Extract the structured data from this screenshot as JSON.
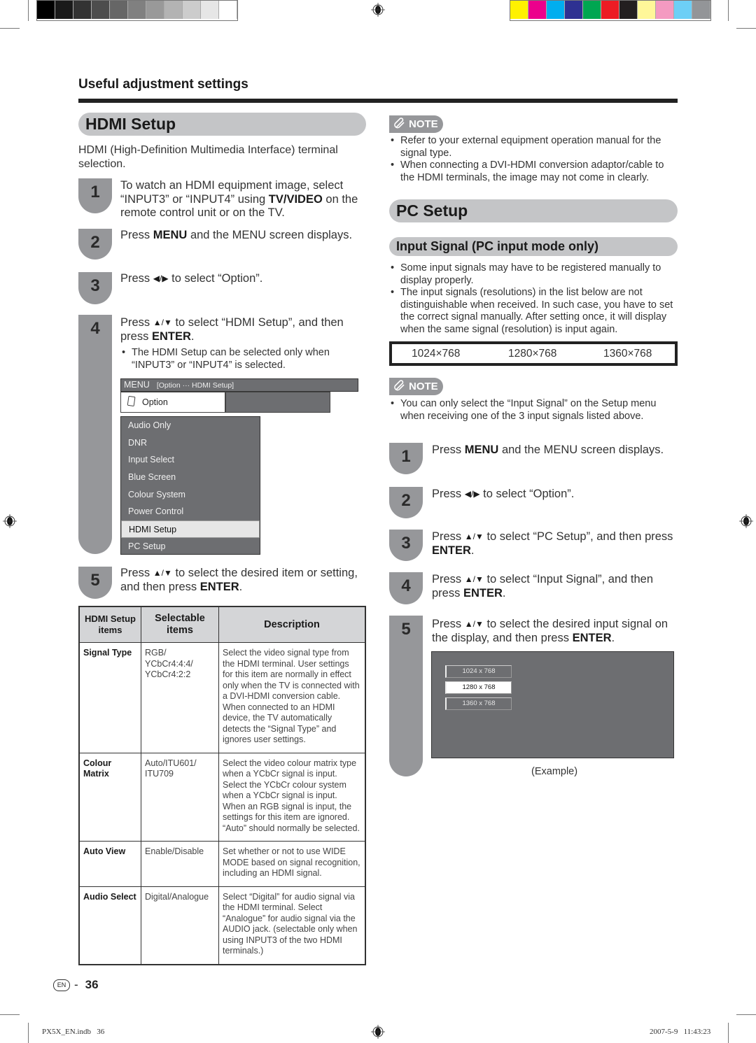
{
  "print_marks": {
    "grayscale_swatches": [
      "#000000",
      "#1a1a1a",
      "#333333",
      "#4d4d4d",
      "#666666",
      "#808080",
      "#999999",
      "#b3b3b3",
      "#cccccc",
      "#e6e6e6",
      "#ffffff"
    ],
    "color_swatches": [
      "#fff100",
      "#ec008c",
      "#00aeef",
      "#2e3192",
      "#00a651",
      "#ed1c24",
      "#231f20",
      "#fff799",
      "#f49ac1",
      "#6dcff6",
      "#939598"
    ]
  },
  "header": {
    "section_title": "Useful adjustment settings"
  },
  "hdmi_setup": {
    "title": "HDMI Setup",
    "intro": "HDMI (High-Definition Multimedia Interface) terminal selection.",
    "steps": [
      {
        "number": "1",
        "parts": [
          "To watch an HDMI equipment image, select “INPUT3” or “INPUT4” using ",
          "TV/VIDEO",
          " on the remote control unit or on the TV."
        ]
      },
      {
        "number": "2",
        "parts": [
          "Press ",
          "MENU",
          " and the MENU screen displays."
        ]
      },
      {
        "number": "3",
        "parts": [
          "Press ",
          "◀/▶",
          " to select “Option”."
        ]
      },
      {
        "number": "4",
        "parts": [
          "Press ",
          "▲/▼",
          " to select  “HDMI Setup”, and then press ",
          "ENTER",
          "."
        ],
        "note": "The HDMI Setup can be selected only when “INPUT3” or “INPUT4” is selected."
      },
      {
        "number": "5",
        "parts": [
          "Press ",
          "▲/▼",
          " to select the desired item or setting, and then press ",
          "ENTER",
          "."
        ]
      }
    ],
    "menu_screen": {
      "menu_label": "MENU",
      "breadcrumb": "[Option ··· HDMI Setup]",
      "tab_label": "Option",
      "items": [
        "Audio Only",
        "DNR",
        "Input Select",
        "Blue Screen",
        "Colour System",
        "Power Control",
        "HDMI Setup",
        "PC Setup"
      ],
      "selected_item": "HDMI Setup"
    },
    "table": {
      "headers": [
        "HDMI Setup items",
        "Selectable items",
        "Description"
      ],
      "rows": [
        {
          "item": "Signal Type",
          "selectable": "RGB/ YCbCr4:4:4/ YCbCr4:2:2",
          "description": "Select the video signal type from the HDMI terminal. User settings for this item are normally in effect only when the TV is connected with a DVI-HDMI conversion cable. When connected to an HDMI device, the TV automatically detects the “Signal Type” and ignores user settings."
        },
        {
          "item": "Colour Matrix",
          "selectable": "Auto/ITU601/ ITU709",
          "description": "Select the video colour matrix type when a YCbCr signal is input. Select the YCbCr colour system when a YCbCr signal is input. When an RGB signal is input, the settings for this item are ignored. “Auto” should normally be selected."
        },
        {
          "item": "Auto View",
          "selectable": "Enable/Disable",
          "description": "Set whether or not to use WIDE MODE based on signal recognition, including an HDMI signal."
        },
        {
          "item": "Audio Select",
          "selectable": "Digital/Analogue",
          "description": "Select “Digital” for audio signal via the HDMI terminal. Select “Analogue” for audio signal via the AUDIO jack. (selectable only when using INPUT3 of the two HDMI terminals.)"
        }
      ]
    }
  },
  "note1": {
    "label": "NOTE",
    "bullets": [
      "Refer to your external equipment operation manual for the signal type.",
      "When connecting a DVI-HDMI conversion adaptor/cable to the HDMI terminals, the image may not come in clearly."
    ]
  },
  "pc_setup": {
    "title": "PC Setup",
    "subtitle": "Input Signal (PC input mode only)",
    "bullets": [
      "Some input signals may have to be registered manually to display properly.",
      "The input signals (resolutions) in the list below are not distinguishable when received. In such case, you have to set the correct signal manually. After setting once, it will display when the same signal (resolution) is input again."
    ],
    "resolutions": [
      "1024×768",
      "1280×768",
      "1360×768"
    ],
    "note": {
      "label": "NOTE",
      "bullets": [
        "You can only select the “Input Signal” on the Setup menu when receiving one of the 3 input signals listed above."
      ]
    },
    "steps": [
      {
        "number": "1",
        "parts": [
          "Press ",
          "MENU",
          " and the MENU screen displays."
        ]
      },
      {
        "number": "2",
        "parts": [
          "Press ",
          "◀/▶",
          " to select “Option”."
        ]
      },
      {
        "number": "3",
        "parts": [
          "Press ",
          "▲/▼",
          " to select “PC Setup”, and then press ",
          "ENTER",
          "."
        ]
      },
      {
        "number": "4",
        "parts": [
          "Press ",
          "▲/▼",
          " to select “Input Signal”, and then press ",
          "ENTER",
          "."
        ]
      },
      {
        "number": "5",
        "parts": [
          "Press ",
          "▲/▼",
          " to select the desired input signal on the display, and then press ",
          "ENTER",
          "."
        ]
      }
    ],
    "display_options": [
      "1024 x 768",
      "1280 x 768",
      "1360 x 768"
    ],
    "selected_option": "1280 x 768",
    "example_caption": "(Example)"
  },
  "page": {
    "lang_badge": "EN",
    "separator": "-",
    "number": "36"
  },
  "footer": {
    "file": "PX5X_EN.indb   36",
    "timestamp": "2007-5-9   11:43:23"
  }
}
